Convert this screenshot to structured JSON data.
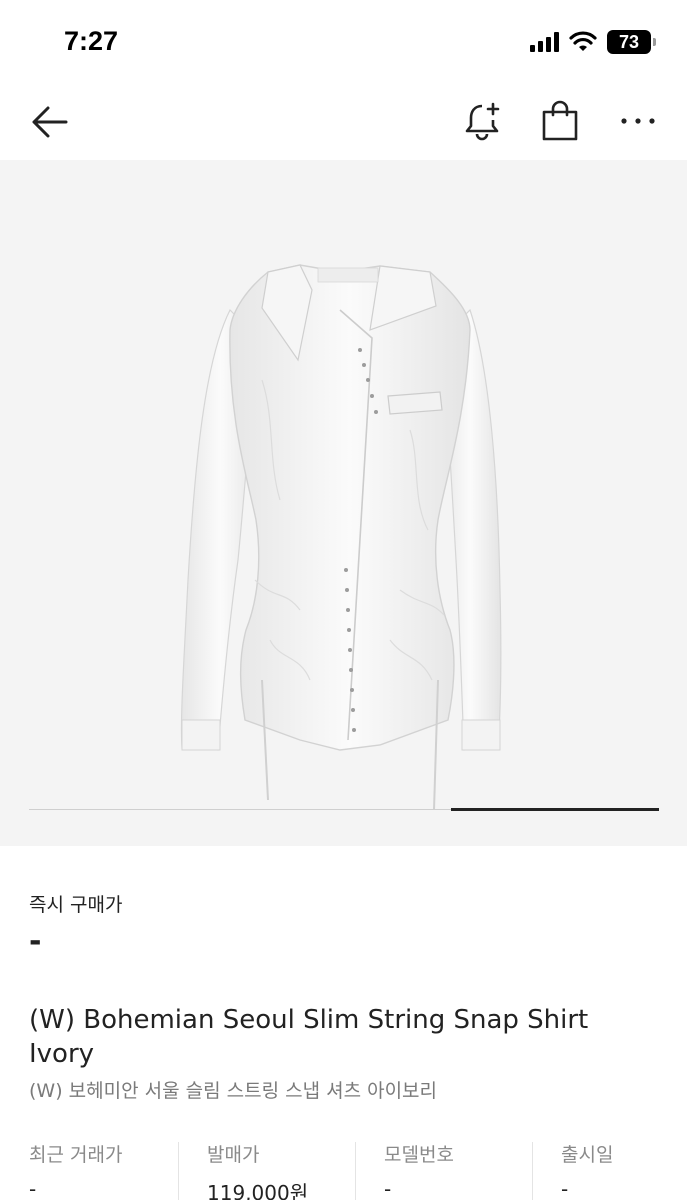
{
  "status_bar": {
    "time": "7:27",
    "battery": "73"
  },
  "nav": {
    "back_icon": "arrow-left-icon",
    "bell_icon": "bell-plus-icon",
    "bag_icon": "shopping-bag-icon",
    "more_icon": "more-horizontal-icon"
  },
  "product": {
    "image_icon": "white-shirt-image",
    "instant_buy_label": "즉시 구매가",
    "instant_buy_value": "-",
    "title": "(W) Bohemian Seoul Slim String Snap Shirt Ivory",
    "subtitle": "(W) 보헤미안 서울 슬림 스트링 스냅 셔츠 아이보리",
    "specs": [
      {
        "label": "최근 거래가",
        "value": "-"
      },
      {
        "label": "발매가",
        "value": "119,000원"
      },
      {
        "label": "모델번호",
        "value": "-"
      },
      {
        "label": "출시일",
        "value": "-"
      }
    ]
  },
  "carousel": {
    "progress": 0.33
  }
}
